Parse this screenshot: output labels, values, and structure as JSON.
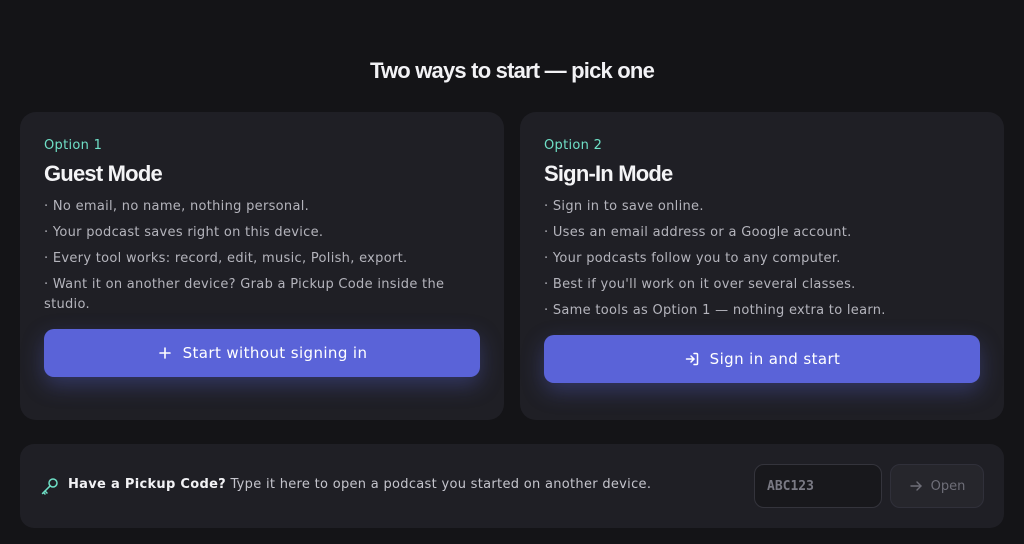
{
  "page": {
    "title": "Two ways to start — pick one"
  },
  "guest": {
    "eyebrow": "Option 1",
    "title": "Guest Mode",
    "bullets": [
      "· No email, no name, nothing personal.",
      "· Your podcast saves right on this device.",
      "· Every tool works: record, edit, music, Polish, export.",
      "· Want it on another device? Grab a Pickup Code inside the studio."
    ],
    "cta_label": "Start without signing in",
    "cta_icon": "plus-icon"
  },
  "signin": {
    "eyebrow": "Option 2",
    "title": "Sign-In Mode",
    "bullets": [
      "· Sign in to save online.",
      "· Uses an email address or a Google account.",
      "· Your podcasts follow you to any computer.",
      "· Best if you'll work on it over several classes.",
      "· Same tools as Option 1 — nothing extra to learn."
    ],
    "cta_label": "Sign in and start",
    "cta_icon": "login-icon"
  },
  "pickup": {
    "icon": "key-icon",
    "label_bold": "Have a Pickup Code?",
    "label_rest": " Type it here to open a podcast you started on another device.",
    "input_placeholder": "ABC123",
    "input_value": "",
    "open_label": "Open",
    "open_icon": "arrow-right-icon"
  },
  "colors": {
    "background": "#141417",
    "card": "#1f1f25",
    "accent": "#5a63d8",
    "eyebrow": "#6fe0c7"
  }
}
